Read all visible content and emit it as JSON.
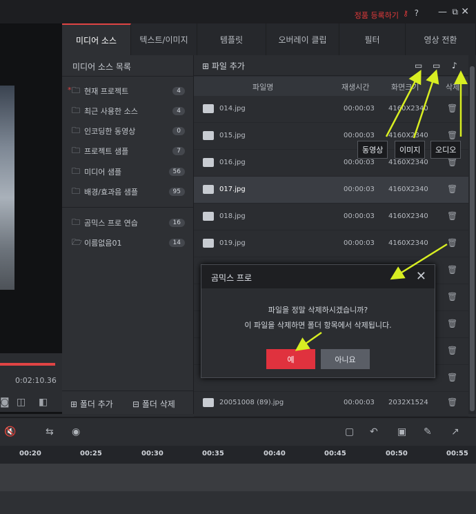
{
  "topbar": {
    "register_label": "정품 등록하기",
    "help_glyph": "?",
    "min_glyph": "—",
    "max_glyph": "⧉",
    "close_glyph": "✕"
  },
  "preview": {
    "total_time": "0:02:10.36"
  },
  "tabs": [
    {
      "label": "미디어 소스",
      "active": true
    },
    {
      "label": "텍스트/이미지"
    },
    {
      "label": "템플릿"
    },
    {
      "label": "오버레이 클립"
    },
    {
      "label": "필터"
    },
    {
      "label": "영상 전환"
    }
  ],
  "source_panel": {
    "title": "미디어 소스 목록",
    "items": [
      {
        "label": "현재 프로젝트",
        "count": "4"
      },
      {
        "label": "최근 사용한 소스",
        "count": "4"
      },
      {
        "label": "인코딩한 동영상",
        "count": "0"
      },
      {
        "label": "프로젝트 샘플",
        "count": "7"
      },
      {
        "label": "미디어 샘플",
        "count": "56"
      },
      {
        "label": "배경/효과음 샘플",
        "count": "95"
      }
    ],
    "user_items": [
      {
        "label": "곰믹스 프로 연습",
        "count": "16"
      },
      {
        "label": "이름없음01",
        "count": "14"
      }
    ],
    "add_folder": "폴더 추가",
    "delete_folder": "폴더 삭제"
  },
  "files": {
    "add_file": "파일 추가",
    "columns": {
      "name": "파일명",
      "duration": "재생시간",
      "resolution": "화면크기",
      "delete": "삭제"
    },
    "rows": [
      {
        "name": "014.jpg",
        "duration": "00:00:03",
        "resolution": "4160X2340"
      },
      {
        "name": "015.jpg",
        "duration": "00:00:03",
        "resolution": "4160X2340"
      },
      {
        "name": "016.jpg",
        "duration": "00:00:03",
        "resolution": "4160X2340"
      },
      {
        "name": "017.jpg",
        "duration": "00:00:03",
        "resolution": "4160X2340",
        "selected": true
      },
      {
        "name": "018.jpg",
        "duration": "00:00:03",
        "resolution": "4160X2340"
      },
      {
        "name": "019.jpg",
        "duration": "00:00:03",
        "resolution": "4160X2340"
      },
      {
        "name": "20051008 (89).jpg",
        "duration": "00:00:03",
        "resolution": "2032X1524"
      }
    ]
  },
  "tooltips": {
    "video": "동영상",
    "image": "이미지",
    "audio": "오디오"
  },
  "dialog": {
    "title": "곰믹스 프로",
    "line1": "파일을 정말 삭제하시겠습니까?",
    "line2": "이 파일을 삭제하면 폴더 항목에서 삭제됩니다.",
    "yes": "예",
    "no": "아니요"
  },
  "timeline": {
    "ticks": [
      "00:20",
      "00:25",
      "00:30",
      "00:35",
      "00:40",
      "00:45",
      "00:50",
      "00:55"
    ]
  },
  "colors": {
    "accent": "#e0323e",
    "annotation_arrow": "#d8ee22"
  }
}
